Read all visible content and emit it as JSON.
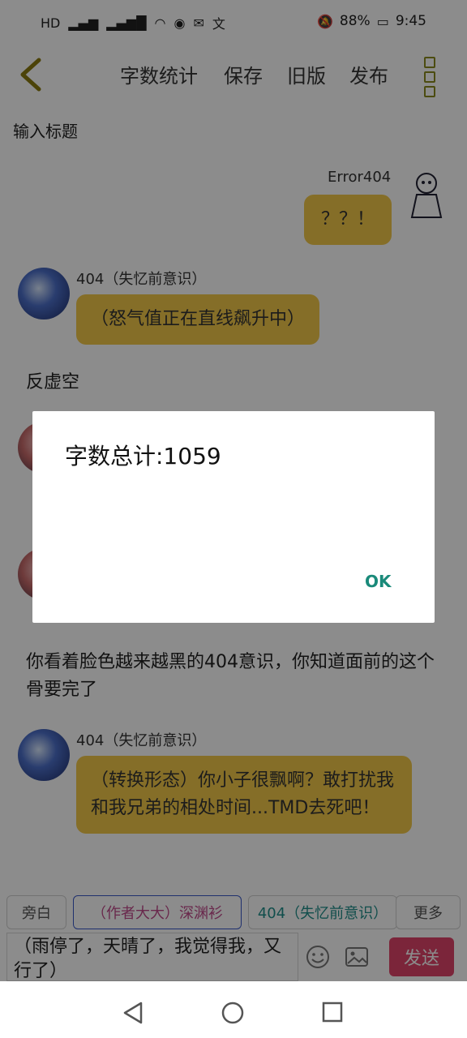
{
  "status": {
    "left_icons": [
      "hd-icon",
      "signal-icon",
      "signal-icon",
      "wifi-icon",
      "browser-icon",
      "mail-icon",
      "translate-icon"
    ],
    "battery": "88%",
    "time": "9:45"
  },
  "toolbar": {
    "word_count": "字数统计",
    "save": "保存",
    "old_version": "旧版",
    "publish": "发布"
  },
  "title_placeholder": "输入标题",
  "messages": [
    {
      "name": "Error404",
      "text": "？？！",
      "side": "right"
    },
    {
      "name": "404（失忆前意识）",
      "text": "（怒气值正在直线飙升中）",
      "side": "left"
    },
    {
      "narration": "反虚空"
    },
    {
      "narration": "你看着脸色越来越黑的404意识，你知道面前的这个骨要完了"
    },
    {
      "name": "404（失忆前意识）",
      "text": "（转换形态）你小子很飘啊？敢打扰我和我兄弟的相处时间...TMD去死吧！",
      "side": "left"
    }
  ],
  "roles": {
    "narration": "旁白",
    "author": "（作者大大）深渊衫",
    "character": "404（失忆前意识）",
    "more": "更多"
  },
  "input_text": "（雨停了，天晴了，我觉得我，又行了）",
  "send": "发送",
  "dialog": {
    "title": "字数总计:1059",
    "ok": "OK"
  },
  "colors": {
    "bubble": "#f2c84a",
    "send_button": "#e0446a",
    "ok_text": "#1a8a7a"
  }
}
